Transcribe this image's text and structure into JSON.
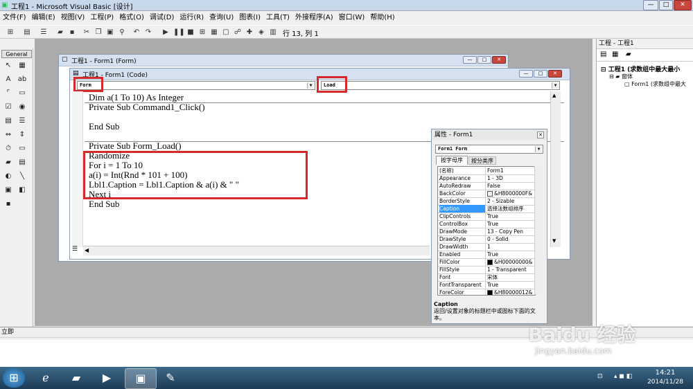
{
  "window": {
    "title": "工程1 - Microsoft Visual Basic [设计]",
    "min": "—",
    "max": "□",
    "close": "✕"
  },
  "menu": [
    "文件(F)",
    "编辑(E)",
    "视图(V)",
    "工程(P)",
    "格式(O)",
    "调试(D)",
    "运行(R)",
    "查询(U)",
    "图表(I)",
    "工具(T)",
    "外接程序(A)",
    "窗口(W)",
    "帮助(H)"
  ],
  "toolbar": {
    "position": "行 13, 列 1"
  },
  "toolbox": {
    "header": "General"
  },
  "form_window": {
    "title": "工程1 - Form1 (Form)"
  },
  "code_window": {
    "title": "工程1 - Form1 (Code)",
    "object_combo": "Form",
    "proc_combo": "Load",
    "lines": [
      "Dim a(1 To 10) As Integer",
      "Private Sub Command1_Click()",
      "",
      "End Sub",
      "",
      "Private Sub Form_Load()",
      "Randomize",
      "For i = 1 To 10",
      "a(i) = Int(Rnd * 101 + 100)",
      "Lbl1.Caption = Lbl1.Caption & a(i) & \" \"",
      "Next i",
      "End Sub"
    ]
  },
  "properties": {
    "title": "属性 - Form1",
    "object": "Form1 Form",
    "tabs": [
      "按字母序",
      "按分类序"
    ],
    "rows": [
      {
        "name": "(名称)",
        "value": "Form1"
      },
      {
        "name": "Appearance",
        "value": "1 - 3D"
      },
      {
        "name": "AutoRedraw",
        "value": "False"
      },
      {
        "name": "BackColor",
        "value": "&H8000000F&",
        "color": "#f0f0f0"
      },
      {
        "name": "BorderStyle",
        "value": "2 - Sizable"
      },
      {
        "name": "Caption",
        "value": "选择法数组排序",
        "selected": true
      },
      {
        "name": "ClipControls",
        "value": "True"
      },
      {
        "name": "ControlBox",
        "value": "True"
      },
      {
        "name": "DrawMode",
        "value": "13 - Copy Pen"
      },
      {
        "name": "DrawStyle",
        "value": "0 - Solid"
      },
      {
        "name": "DrawWidth",
        "value": "1"
      },
      {
        "name": "Enabled",
        "value": "True"
      },
      {
        "name": "FillColor",
        "value": "&H00000000&",
        "color": "#000000"
      },
      {
        "name": "FillStyle",
        "value": "1 - Transparent"
      },
      {
        "name": "Font",
        "value": "宋体"
      },
      {
        "name": "FontTransparent",
        "value": "True"
      },
      {
        "name": "ForeColor",
        "value": "&H80000012&",
        "color": "#000000"
      }
    ],
    "desc_title": "Caption",
    "desc_text": "返回/设置对象的标题栏中或图标下面的文本。"
  },
  "project": {
    "title": "工程 - 工程1",
    "root": "工程1 (求数组中最大最小",
    "folder": "窗体",
    "form": "Form1 (求数组中最大"
  },
  "immediate": {
    "title": "立即"
  },
  "tray": {
    "time": "14:21",
    "date": "2014/11/28"
  },
  "watermark": {
    "main": "Baidu 经验",
    "sub": "jingyan.baidu.com"
  }
}
